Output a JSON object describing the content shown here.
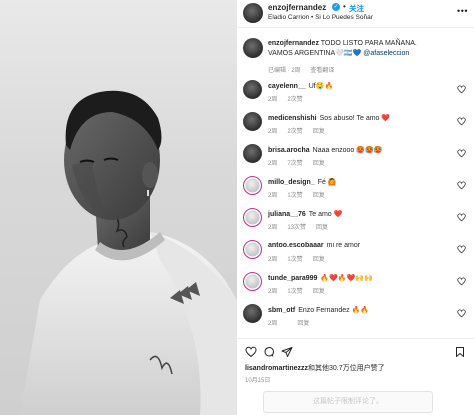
{
  "post": {
    "username": "enzojfernandez",
    "verified_badge": "✓",
    "follow_label": "关注",
    "subtitle": "Eladio Carrion • Si Lo Puedes Soñar",
    "more_icon": "more-horizontal-icon"
  },
  "caption": {
    "username": "enzojfernandez",
    "text": "TODO LISTO PARA MAÑANA. VAMOS ARGENTINA🤍🇦🇷💙",
    "mention": "@afaseleccion",
    "time": "已编辑 · 2周",
    "translate": "查看翻译"
  },
  "comments": [
    {
      "username": "cayelenn__",
      "text": "Uf🤤🔥",
      "time": "2周",
      "likes": "2次赞",
      "reply": "",
      "ring": false
    },
    {
      "username": "medicenshishi",
      "text": "Sos abuso! Te amo ❤️",
      "time": "2周",
      "likes": "2次赞",
      "reply": "回复",
      "ring": false
    },
    {
      "username": "brisa.arocha",
      "text": "Naaa enzooo 🥵🥵🥵",
      "time": "2周",
      "likes": "7次赞",
      "reply": "回复",
      "ring": false
    },
    {
      "username": "millo_design_",
      "text": "Fé 🙆",
      "time": "2周",
      "likes": "1次赞",
      "reply": "回复",
      "ring": true
    },
    {
      "username": "juliana__76",
      "text": "Te amo ❤️",
      "time": "2周",
      "likes": "13次赞",
      "reply": "回复",
      "ring": true
    },
    {
      "username": "antoo.escobaaar",
      "text": "mi re amor",
      "time": "2周",
      "likes": "1次赞",
      "reply": "回复",
      "ring": true
    },
    {
      "username": "tunde_para999",
      "text": "🔥❤️🔥❤️🙌🙌",
      "time": "2周",
      "likes": "1次赞",
      "reply": "回复",
      "ring": true
    },
    {
      "username": "sbm_otf",
      "text": "Enzo Fernandez 🔥🔥",
      "time": "2周",
      "likes": "",
      "reply": "回复",
      "ring": false
    }
  ],
  "actions": {
    "like_icon": "heart-icon",
    "comment_icon": "comment-icon",
    "share_icon": "share-icon",
    "save_icon": "bookmark-icon"
  },
  "likes_line": {
    "user": "lisandromartinezzz",
    "rest": "和其他30.7万位用户赞了"
  },
  "date": "10月15日",
  "comments_closed": "这篇帖子限制评论了。"
}
